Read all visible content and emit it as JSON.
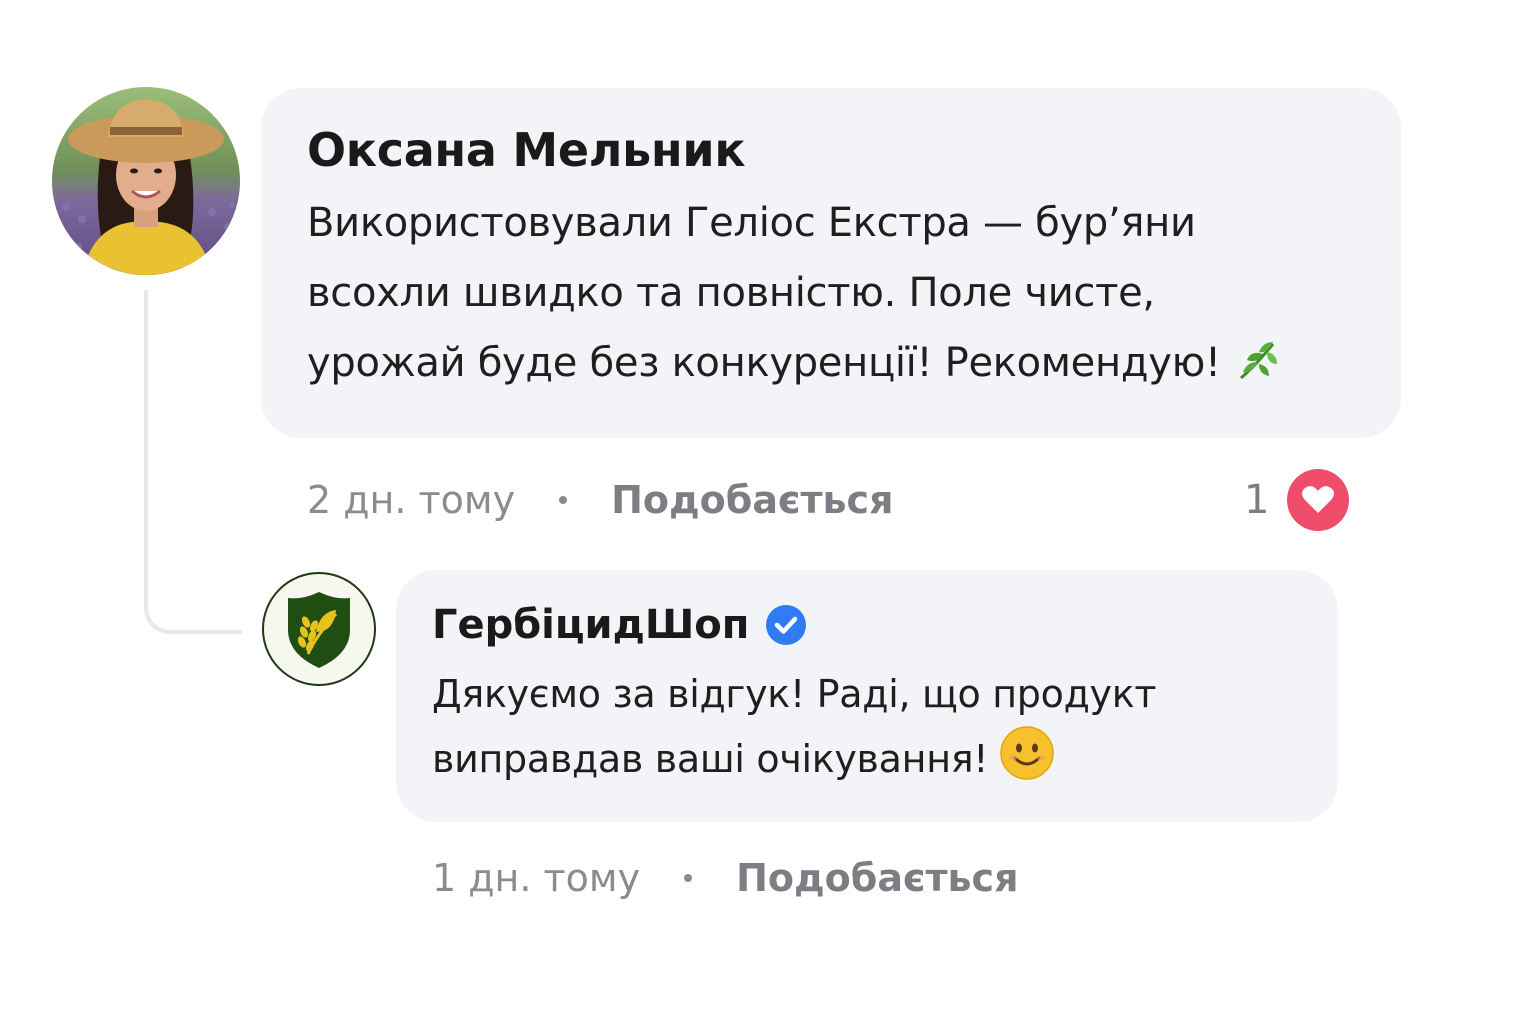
{
  "comment": {
    "author": "Оксана Мельник",
    "text_lines": [
      "Використовували Геліос Екстра — бур’яни",
      "всохли швидко та повністю. Поле чисте,",
      "урожай буде без конкуренції! Рекомендую!"
    ],
    "emoji": "herb-icon",
    "time": "2 дн. тому",
    "separator": "•",
    "like_label": "Подобається",
    "reaction_count": "1",
    "reaction_icon": "heart-icon"
  },
  "reply": {
    "author": "ГербіцидШоп",
    "verified_icon": "verified-badge-icon",
    "text_lines": [
      "Дякуємо за відгук! Раді, що продукт",
      "виправдав ваші очікування!"
    ],
    "emoji": "smiling-face-icon",
    "time": "1 дн. тому",
    "separator": "•",
    "like_label": "Подобається"
  },
  "colors": {
    "bubble_bg": "#f3f4f8",
    "meta_text": "#8b8c92",
    "heart": "#ef4d6b",
    "verified": "#2f7cf6",
    "logo_green": "#1f4d12",
    "logo_yellow": "#e6c21a"
  }
}
